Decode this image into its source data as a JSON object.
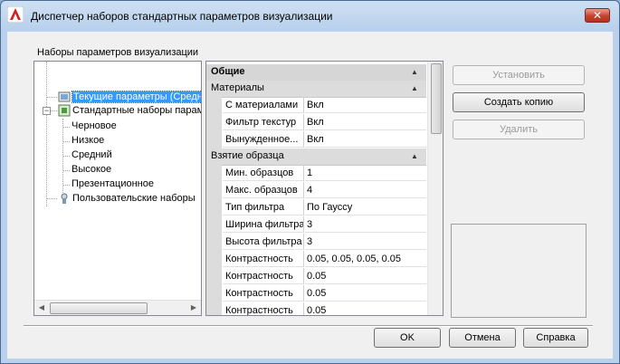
{
  "window": {
    "title": "Диспетчер наборов стандартных параметров визуализации",
    "close_label": "✕"
  },
  "tree": {
    "group_label": "Наборы параметров визуализации",
    "items": [
      {
        "label": "Текущие параметры (Средний)",
        "level": 0,
        "selected": true,
        "icon": "current-preset-icon"
      },
      {
        "label": "Стандартные наборы параметров",
        "level": 0,
        "expander": "−",
        "icon": "standard-presets-icon"
      },
      {
        "label": "Черновое",
        "level": 1
      },
      {
        "label": "Низкое",
        "level": 1
      },
      {
        "label": "Средний",
        "level": 1
      },
      {
        "label": "Высокое",
        "level": 1
      },
      {
        "label": "Презентационное",
        "level": 1
      },
      {
        "label": "Пользовательские наборы",
        "level": 0,
        "icon": "custom-presets-icon"
      }
    ],
    "hscroll": {
      "left_arrow": "◀",
      "right_arrow": "▶"
    }
  },
  "properties": {
    "header": "Общие",
    "collapse_glyph": "▲",
    "categories": [
      {
        "name": "Материалы",
        "rows": [
          {
            "name": "С материалами",
            "value": "Вкл"
          },
          {
            "name": "Фильтр текстур",
            "value": "Вкл"
          },
          {
            "name": "Вынужденное...",
            "value": "Вкл"
          }
        ]
      },
      {
        "name": "Взятие образца",
        "rows": [
          {
            "name": "Мин. образцов",
            "value": "1"
          },
          {
            "name": "Макс. образцов",
            "value": "4"
          },
          {
            "name": "Тип фильтра",
            "value": "По Гауссу"
          },
          {
            "name": "Ширина фильтра",
            "value": "3"
          },
          {
            "name": "Высота фильтра",
            "value": "3"
          },
          {
            "name": "Контрастность",
            "value": "0.05, 0.05, 0.05, 0.05"
          },
          {
            "name": "Контрастность",
            "value": "0.05"
          },
          {
            "name": "Контрастность",
            "value": "0.05"
          },
          {
            "name": "Контрастность",
            "value": "0.05"
          }
        ]
      }
    ]
  },
  "buttons": {
    "set_current": "Установить",
    "create_copy": "Создать копию",
    "delete": "Удалить",
    "ok": "OK",
    "cancel": "Отмена",
    "help": "Справка"
  },
  "colors": {
    "selection": "#3399ff",
    "title_gradient": "#b9d1ec",
    "close": "#c5432f"
  }
}
